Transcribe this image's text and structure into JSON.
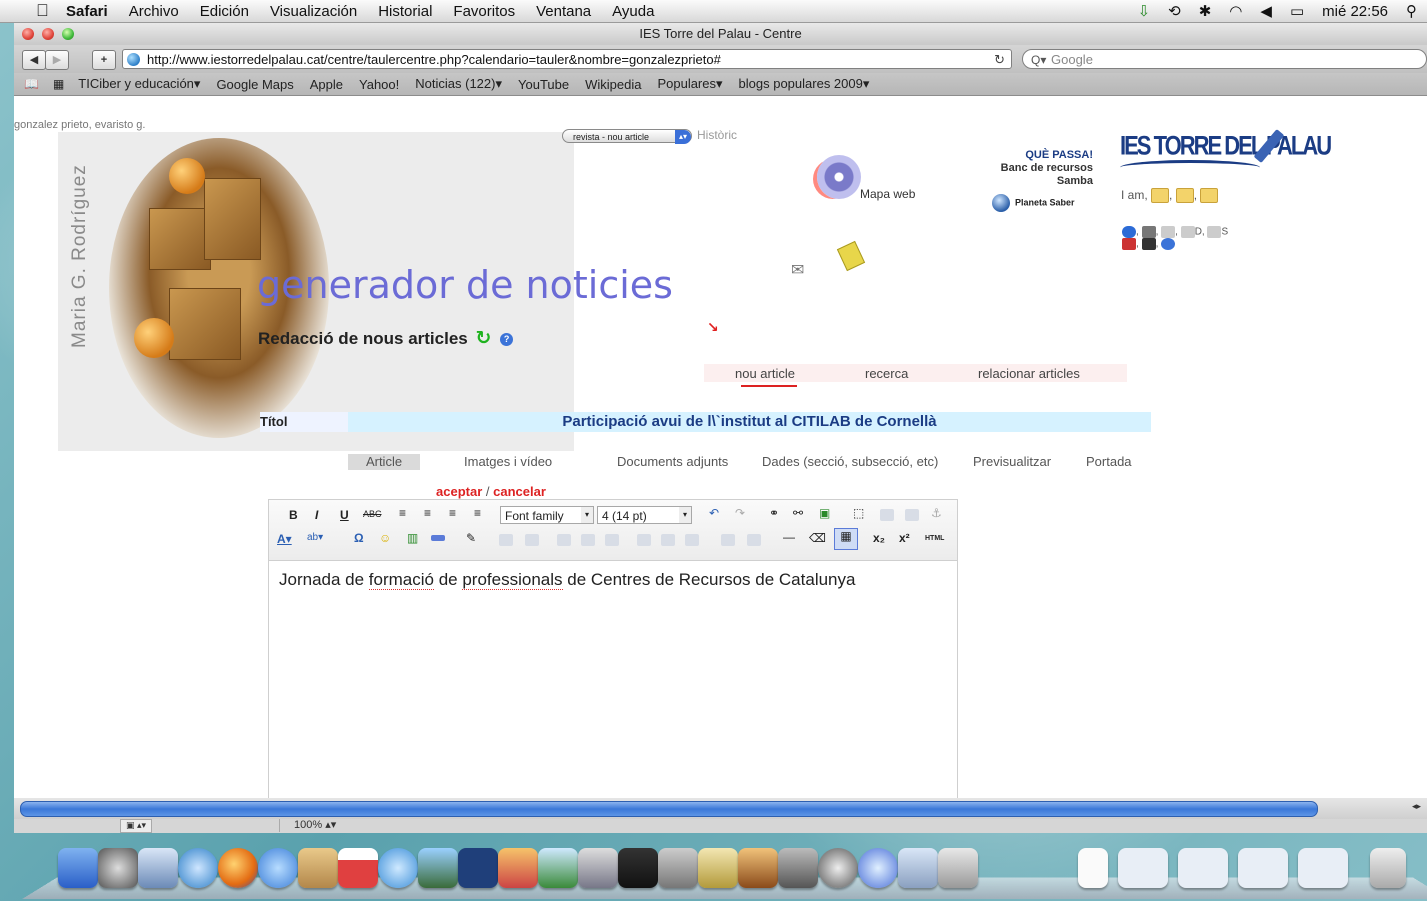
{
  "menubar": {
    "app": "Safari",
    "items": [
      "Archivo",
      "Edición",
      "Visualización",
      "Historial",
      "Favoritos",
      "Ventana",
      "Ayuda"
    ],
    "clock": "mié 22:56"
  },
  "window": {
    "title": "IES Torre del Palau - Centre",
    "url": "http://www.iestorredelpalau.cat/centre/taulercentre.php?calendario=tauler&nombre=gonzalezprieto#",
    "search_placeholder": "Google"
  },
  "bookmarks": [
    "TICiber y educación▾",
    "Google Maps",
    "Apple",
    "Yahoo!",
    "Noticias (122)▾",
    "YouTube",
    "Wikipedia",
    "Populares▾",
    "blogs populares 2009▾"
  ],
  "page": {
    "user": "gonzalez prieto, evaristo g.",
    "vertical_name": "Maria G. Rodríguez",
    "select_value": "revista - nou article",
    "historic": "Històric",
    "mapa_web": "Mapa web",
    "que_passa": "QUÈ PASSA!",
    "banc_line1": "Banc de recursos",
    "banc_line2": "Samba",
    "planeta": "Planeta Saber",
    "logo": "IES TORRE DEL PALAU",
    "iam": "I am,",
    "icons_text_d": "D,",
    "icons_text_s": "S",
    "generator_title": "generador de noticies",
    "redaccio": "Redacció de nous articles",
    "top_tabs": [
      "nou article",
      "recerca",
      "relacionar articles"
    ],
    "titol_label": "Títol",
    "titol_value": "Participació avui de l\\`institut al CITILAB de Cornellà",
    "sub_tabs": [
      "Article",
      "Imatges i vídeo",
      "Documents adjunts",
      "Dades (secció, subsecció, etc)",
      "Previsualitzar",
      "Portada"
    ],
    "accept": "aceptar",
    "cancel": "cancelar",
    "editor": {
      "font_family": "Font family",
      "font_size": "4 (14 pt)",
      "text_part1": "Jornada de ",
      "text_word1": "formació",
      "text_part2": " de ",
      "text_word2": "professionals",
      "text_part3": " de Centres de Recursos de Catalunya"
    }
  },
  "statusbar": {
    "zoom": "100%"
  }
}
